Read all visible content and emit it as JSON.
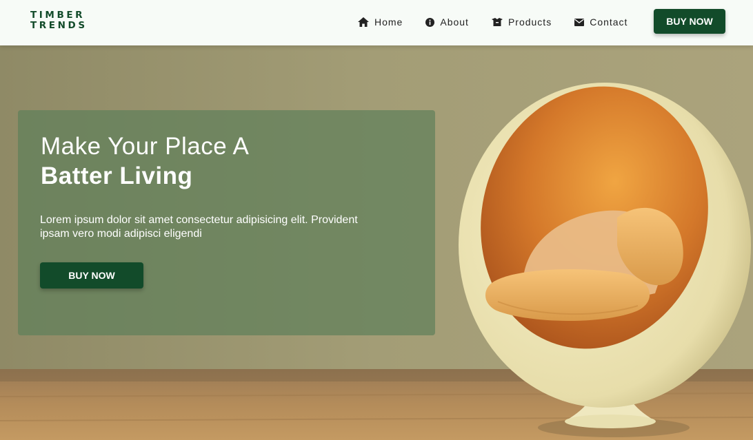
{
  "brand": {
    "line1": "TIMBER",
    "line2": "TRENDS",
    "color": "#124b2a"
  },
  "nav": {
    "items": [
      {
        "label": "Home",
        "icon": "home-icon"
      },
      {
        "label": "About",
        "icon": "info-circle-icon"
      },
      {
        "label": "Products",
        "icon": "box-icon"
      },
      {
        "label": "Contact",
        "icon": "envelope-icon"
      }
    ],
    "cta_label": "BUY NOW"
  },
  "hero": {
    "title_line1": "Make Your Place A",
    "title_line2": "Batter Living",
    "description": "Lorem ipsum dolor sit amet consectetur adipisicing elit. Provident ipsam vero modi adipisci eligendi",
    "cta_label": "BUY NOW",
    "image": "egg-chair-photo"
  },
  "colors": {
    "accent": "#124b2a",
    "navbar_bg": "#f7fbf7",
    "card_overlay": "#60805a"
  }
}
